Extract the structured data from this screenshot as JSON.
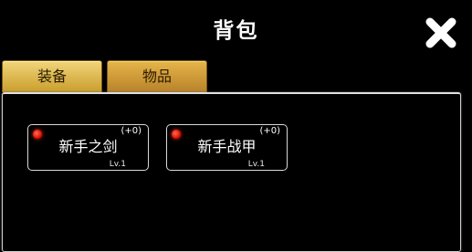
{
  "header": {
    "title": "背包",
    "close_icon": "close-x-icon"
  },
  "tabs": [
    {
      "label": "装备",
      "active": true
    },
    {
      "label": "物品",
      "active": false
    }
  ],
  "items": [
    {
      "name": "新手之剑",
      "bonus": "(+0)",
      "level": "Lv.1"
    },
    {
      "name": "新手战甲",
      "bonus": "(+0)",
      "level": "Lv.1"
    }
  ],
  "colors": {
    "background": "#000000",
    "tab_active": "#e3c05c",
    "tab_inactive": "#d49e3c",
    "indicator_dot": "#e01400"
  }
}
